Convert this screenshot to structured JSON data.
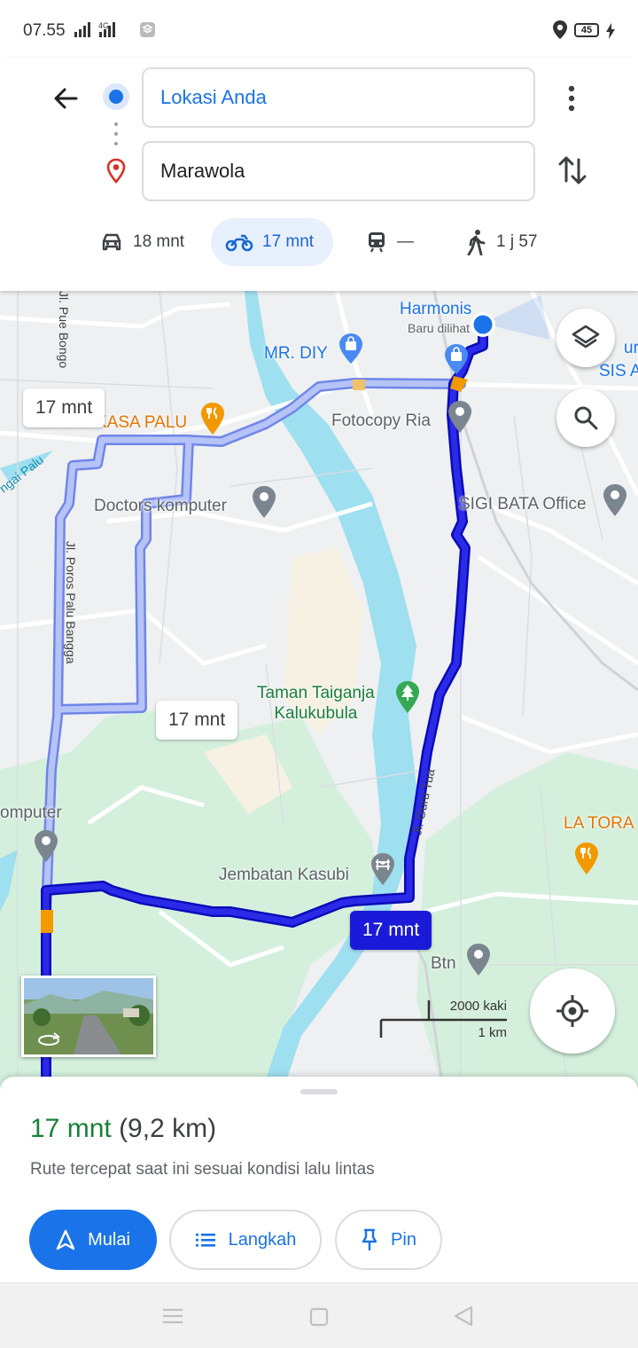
{
  "status_bar": {
    "time": "07.55",
    "network": "4G",
    "battery": "45",
    "icons": [
      "signal-icon",
      "data-signal-icon",
      "app-notification-icon",
      "location-icon",
      "battery-icon",
      "charging-icon"
    ]
  },
  "directions": {
    "origin": "Lokasi Anda",
    "destination": "Marawola",
    "modes": [
      {
        "name": "car",
        "label": "18 mnt",
        "selected": false
      },
      {
        "name": "motorcycle",
        "label": "17 mnt",
        "selected": true
      },
      {
        "name": "transit",
        "label": "—",
        "selected": false
      },
      {
        "name": "walk",
        "label": "1 j 57",
        "selected": false
      }
    ]
  },
  "map": {
    "pois": {
      "harmonis": "Harmonis",
      "harmonis_sub": "Baru dilihat",
      "mr_diy": "MR. DIY",
      "rasa_kasa": "RASA KASA PALU",
      "fotocopy": "Fotocopy Ria",
      "doctors": "Doctors komputer",
      "sigi_bata": "SIGI BATA Office",
      "taman_line1": "Taman Taiganja",
      "taman_line2": "Kalukubula",
      "komputer": "omputer",
      "la_tora": "LA TORA",
      "jembatan": "Jembatan Kasubi",
      "btn": "Btn",
      "edge_right1": "ur U",
      "edge_right2": "SIS A"
    },
    "streets": {
      "pue_bongo": "Jl. Pue Bongo",
      "poros": "Jl. Poros Palu Bangga",
      "guru_tua": "Jl. Guru Tua",
      "sungai": "ngai Palu"
    },
    "route_bubbles": {
      "alt1": "17 mnt",
      "alt2": "17 mnt",
      "main": "17 mnt"
    },
    "scale": {
      "top": "2000 kaki",
      "bottom": "1 km"
    }
  },
  "route_sheet": {
    "duration": "17 mnt",
    "distance": "(9,2 km)",
    "note": "Rute tercepat saat ini sesuai kondisi lalu lintas",
    "start_label": "Mulai",
    "steps_label": "Langkah",
    "pin_label": "Pin"
  },
  "colors": {
    "accent": "#1a73e8",
    "route_main": "#1a1ad8",
    "route_alt": "#a8b8f8",
    "duration_green": "#188038",
    "water": "#9edff0",
    "park": "#d4f0dc"
  }
}
